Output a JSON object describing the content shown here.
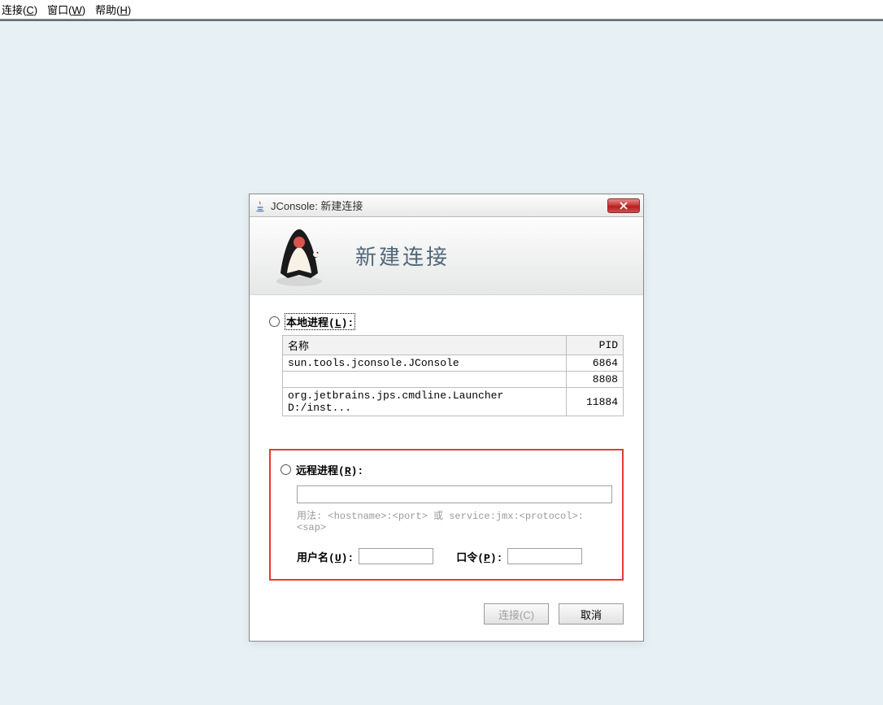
{
  "menubar": {
    "connect": {
      "text": "连接",
      "mnemonic": "C"
    },
    "window": {
      "text": "窗口",
      "mnemonic": "W"
    },
    "help": {
      "text": "帮助",
      "mnemonic": "H"
    }
  },
  "dialog": {
    "title": "JConsole: 新建连接",
    "header_title": "新建连接",
    "local_section": {
      "label_prefix": "本地进程(",
      "mnemonic": "L",
      "label_suffix": "):",
      "columns": {
        "name": "名称",
        "pid": "PID"
      },
      "rows": [
        {
          "name": "sun.tools.jconsole.JConsole",
          "pid": "6864"
        },
        {
          "name": "",
          "pid": "8808"
        },
        {
          "name": "org.jetbrains.jps.cmdline.Launcher D:/inst...",
          "pid": "11884"
        }
      ]
    },
    "remote_section": {
      "label_prefix": "远程进程(",
      "mnemonic": "R",
      "label_suffix": "):",
      "usage": "用法: <hostname>:<port> 或 service:jmx:<protocol>:<sap>",
      "username_label_prefix": "用户名(",
      "username_mnemonic": "U",
      "username_label_suffix": "):",
      "password_label_prefix": "口令(",
      "password_mnemonic": "P",
      "password_label_suffix": "):"
    },
    "buttons": {
      "connect": "连接(C)",
      "cancel": "取消"
    }
  }
}
